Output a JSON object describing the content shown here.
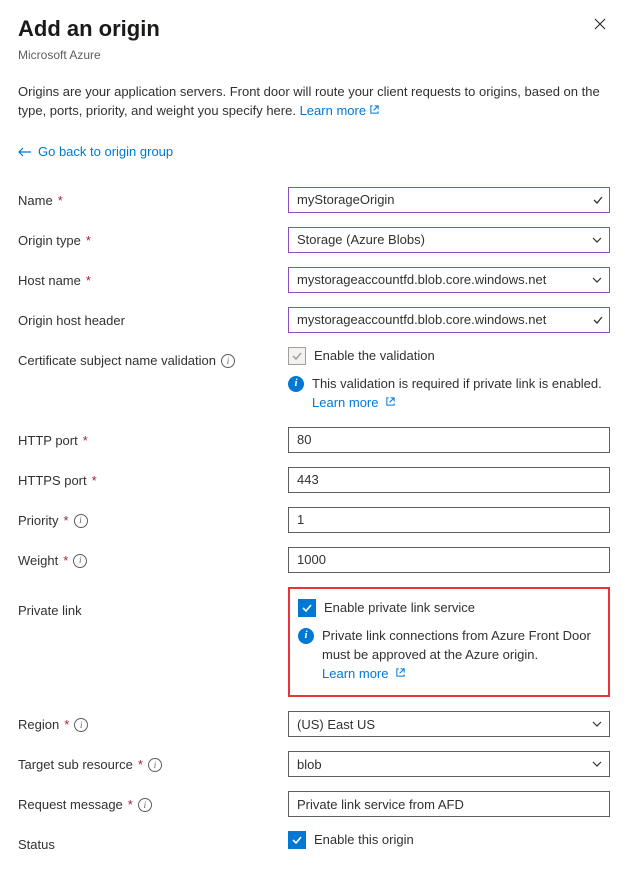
{
  "header": {
    "title": "Add an origin",
    "subtitle": "Microsoft Azure"
  },
  "description": {
    "text": "Origins are your application servers. Front door will route your client requests to origins, based on the type, ports, priority, and weight you specify here. ",
    "link": "Learn more"
  },
  "back_link": "Go back to origin group",
  "fields": {
    "name": {
      "label": "Name",
      "value": "myStorageOrigin"
    },
    "origin_type": {
      "label": "Origin type",
      "value": "Storage (Azure Blobs)"
    },
    "host_name": {
      "label": "Host name",
      "value": "mystorageaccountfd.blob.core.windows.net"
    },
    "origin_host_header": {
      "label": "Origin host header",
      "value": "mystorageaccountfd.blob.core.windows.net"
    },
    "cert_validation": {
      "label": "Certificate subject name validation",
      "checkbox_label": "Enable the validation",
      "info_text": "This validation is required if private link is enabled. ",
      "info_link": "Learn more"
    },
    "http_port": {
      "label": "HTTP port",
      "value": "80"
    },
    "https_port": {
      "label": "HTTPS port",
      "value": "443"
    },
    "priority": {
      "label": "Priority",
      "value": "1"
    },
    "weight": {
      "label": "Weight",
      "value": "1000"
    },
    "private_link": {
      "label": "Private link",
      "checkbox_label": "Enable private link service",
      "info_text": "Private link connections from Azure Front Door must be approved at the Azure origin. ",
      "info_link": "Learn more"
    },
    "region": {
      "label": "Region",
      "value": "(US) East US"
    },
    "target_sub_resource": {
      "label": "Target sub resource",
      "value": "blob"
    },
    "request_message": {
      "label": "Request message",
      "value": "Private link service from AFD"
    },
    "status": {
      "label": "Status",
      "checkbox_label": "Enable this origin"
    }
  }
}
